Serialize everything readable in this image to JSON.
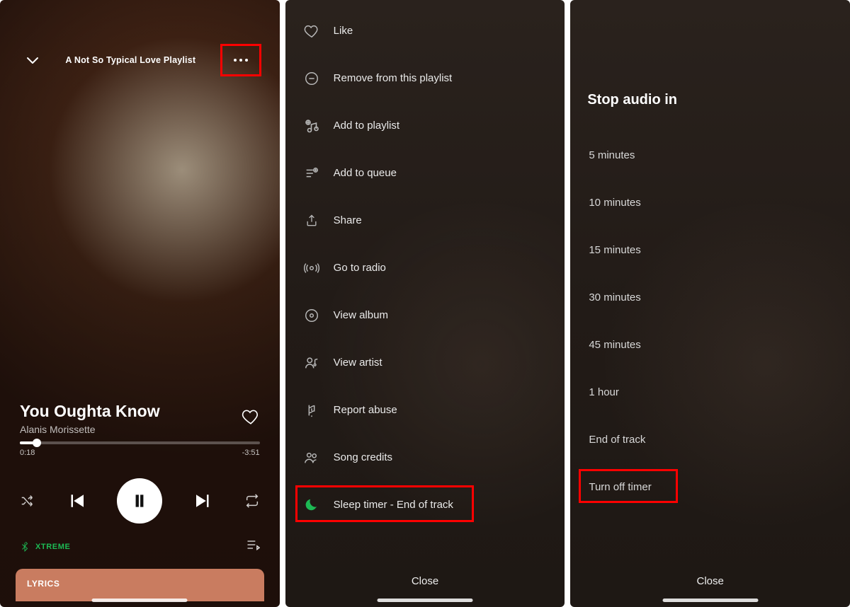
{
  "player": {
    "playlist": "A Not So Typical Love Playlist",
    "track_title": "You Oughta Know",
    "artist": "Alanis Morissette",
    "elapsed": "0:18",
    "remaining": "-3:51",
    "device": "XTREME",
    "lyrics_label": "LYRICS"
  },
  "menu": {
    "items": [
      {
        "icon": "heart",
        "label": "Like"
      },
      {
        "icon": "remove",
        "label": "Remove from this playlist"
      },
      {
        "icon": "add-playlist",
        "label": "Add to playlist"
      },
      {
        "icon": "queue-add",
        "label": "Add to queue"
      },
      {
        "icon": "share",
        "label": "Share"
      },
      {
        "icon": "radio",
        "label": "Go to radio"
      },
      {
        "icon": "album",
        "label": "View album"
      },
      {
        "icon": "artist",
        "label": "View artist"
      },
      {
        "icon": "flag",
        "label": "Report abuse"
      },
      {
        "icon": "people",
        "label": "Song credits"
      },
      {
        "icon": "moon",
        "label": "Sleep timer - End of track",
        "highlight": true
      }
    ],
    "close": "Close"
  },
  "timer": {
    "title": "Stop audio in",
    "options": [
      "5 minutes",
      "10 minutes",
      "15 minutes",
      "30 minutes",
      "45 minutes",
      "1 hour",
      "End of track",
      "Turn off timer"
    ],
    "highlight_index": 7,
    "close": "Close"
  },
  "colors": {
    "accent": "#1DB954",
    "highlight": "#ff0000"
  }
}
